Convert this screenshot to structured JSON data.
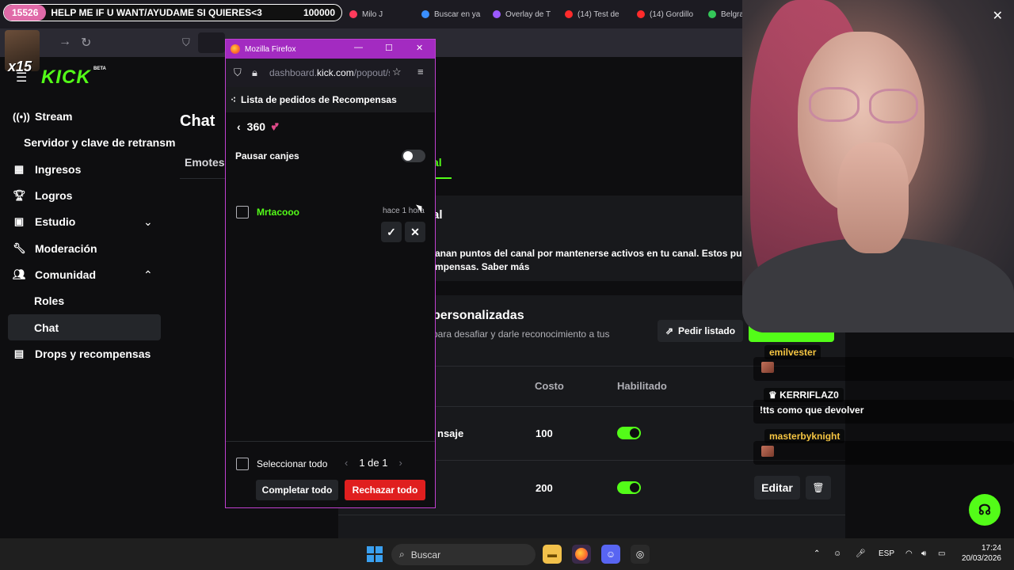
{
  "overlay": {
    "left_count": "15526",
    "message": "HELP ME IF U WANT/AYUDAME SI QUIERES<3",
    "right_count": "100000",
    "combo": "x15"
  },
  "browser_tabs": [
    {
      "label": "Milo J",
      "color": "#ff3b5c"
    },
    {
      "label": "Buscar en ya",
      "color": "#3a8fff"
    },
    {
      "label": "Overlay de T",
      "color": "#9b59ff"
    },
    {
      "label": "(14) Test de",
      "color": "#ff2b2b"
    },
    {
      "label": "(14) Gordillo",
      "color": "#ff2b2b"
    },
    {
      "label": "Belgrano -",
      "color": "#34c759"
    }
  ],
  "kick": {
    "logo": "KICK",
    "beta": "BETA",
    "sidebar": [
      {
        "label": "Stream",
        "icon": "broadcast-icon"
      },
      {
        "label": "Servidor y clave de retransm",
        "icon": ""
      },
      {
        "label": "Ingresos",
        "icon": "revenue-icon"
      },
      {
        "label": "Logros",
        "icon": "trophy-icon"
      },
      {
        "label": "Estudio",
        "icon": "studio-icon"
      },
      {
        "label": "Moderación",
        "icon": "wrench-icon"
      },
      {
        "label": "Comunidad",
        "icon": "community-icon"
      },
      {
        "label": "Roles",
        "icon": ""
      },
      {
        "label": "Chat",
        "icon": ""
      },
      {
        "label": "Drops y recompensas",
        "icon": "drops-icon"
      }
    ],
    "page_title": "Chat",
    "tab_emotes": "Emotes",
    "tab_active": "al",
    "card1_title": "al",
    "card1_text_1": "anan puntos del canal por mantenerse activos en tu canal. Estos punt",
    "card1_text_2": "mpensas. Saber más",
    "card2_title": "personalizadas",
    "card2_sub": "para desafiar y darle reconocimiento a tus",
    "pedir_button": "Pedir listado",
    "col_costo": "Costo",
    "col_habilitado": "Habilitado",
    "rows": [
      {
        "name": "nsaje",
        "cost": "100"
      },
      {
        "name": "",
        "cost": "200"
      }
    ],
    "edit_label": "Editar",
    "edit_label_partial": "Editar"
  },
  "chat_overlay": [
    {
      "user": "emilvester",
      "color": "#f5c542"
    },
    {
      "user": "KERRIFLAZ0",
      "color": "#ffffff",
      "text": "!tts como que devolver"
    },
    {
      "user": "masterbyknight",
      "color": "#f5c542"
    }
  ],
  "popup": {
    "window_title": "Mozilla Firefox",
    "url_prefix": "dashboard.",
    "url_domain": "kick.com",
    "url_suffix": "/popout/s",
    "header": "Lista de pedidos de Recompensas",
    "points": "360",
    "pause_label": "Pausar canjes",
    "request_user": "Mrtacooo",
    "request_time": "hace 1 hora",
    "select_all": "Seleccionar todo",
    "page": "1 de 1",
    "complete_all": "Completar todo",
    "reject_all": "Rechazar todo"
  },
  "taskbar": {
    "search_placeholder": "Buscar",
    "lang": "ESP",
    "time": "17:24",
    "date": "20/03/2026"
  },
  "colors": {
    "kick_green": "#53fc18",
    "firefox_purple": "#a32bc1",
    "reject_red": "#e01f1f"
  }
}
